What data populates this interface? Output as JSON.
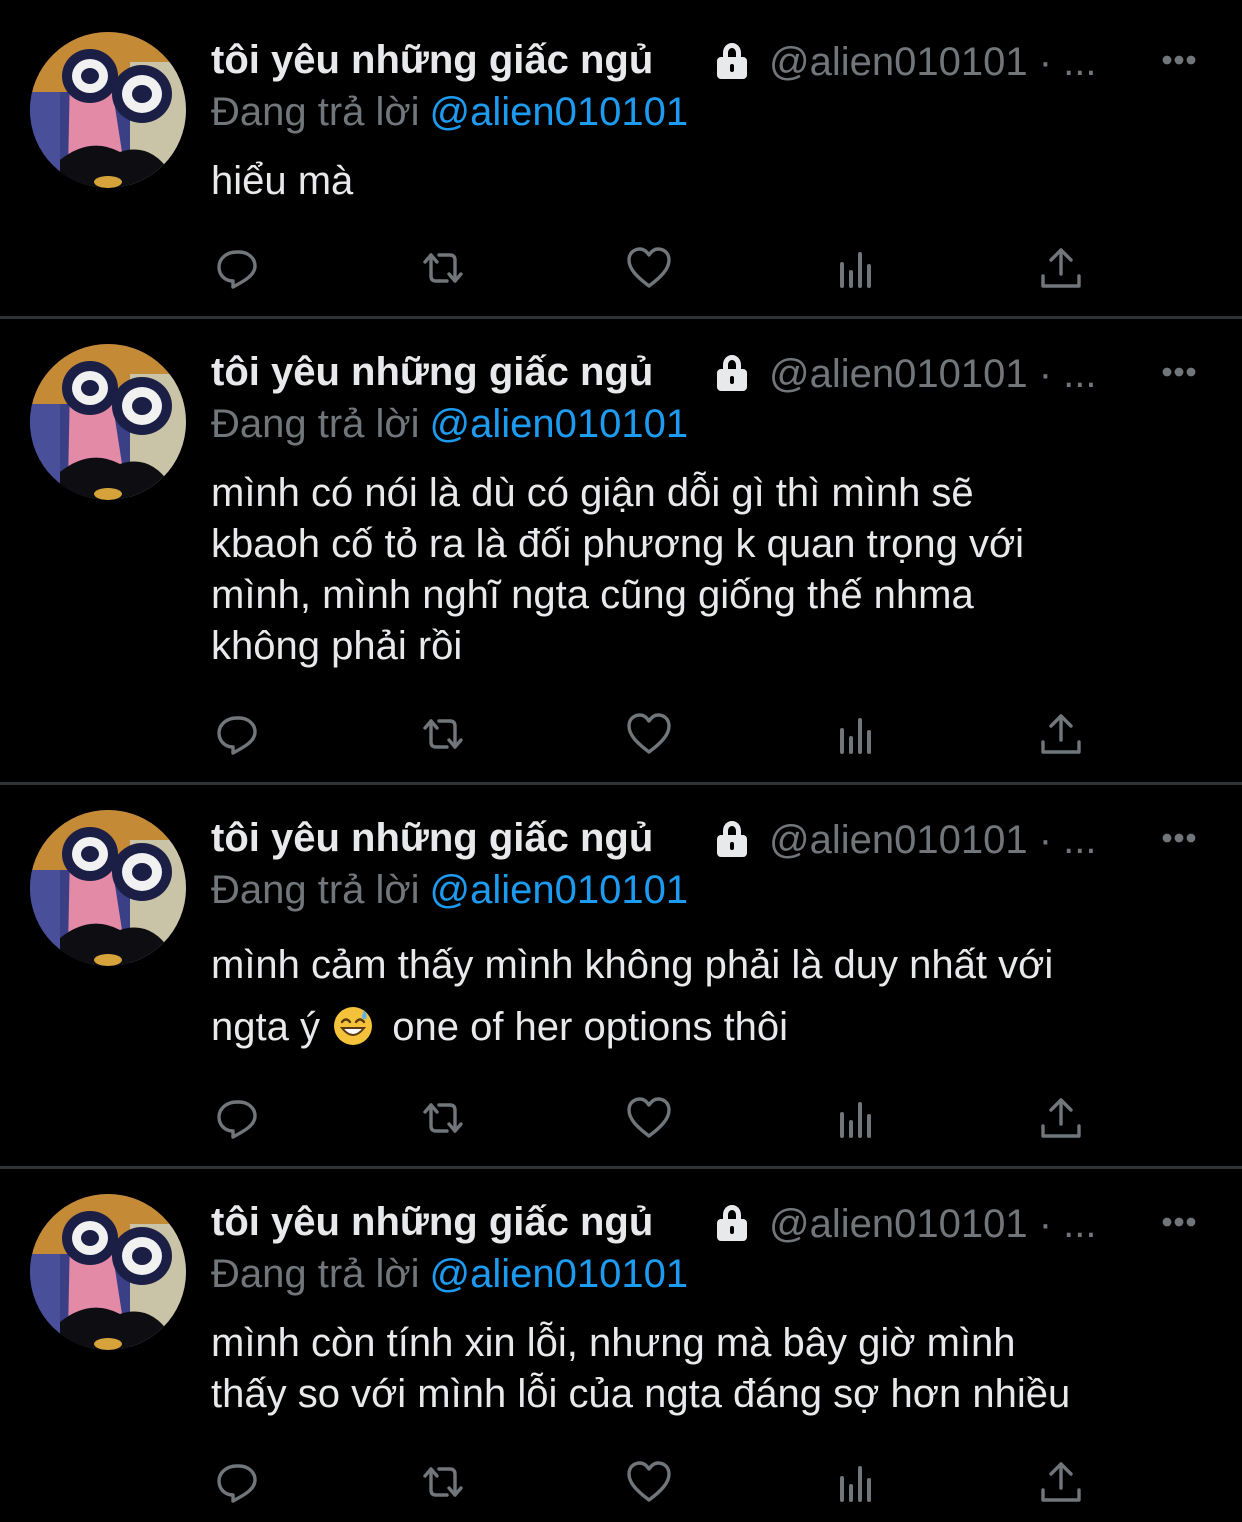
{
  "author": {
    "name": "tôi yêu những giấc ngủ",
    "handle": "@alien010101 · ...",
    "reply_prefix": "Đang trả lời",
    "reply_to": "@alien010101"
  },
  "icons": {
    "lock": "lock-icon",
    "more": "more-icon",
    "reply": "reply-icon",
    "retweet": "retweet-icon",
    "like": "heart-icon",
    "analytics": "analytics-icon",
    "share": "share-icon"
  },
  "colors": {
    "background": "#000000",
    "text": "#e7e9ea",
    "muted": "#71767b",
    "link": "#1d9bf0",
    "divider": "#2f3336"
  },
  "tweets": [
    {
      "lines": [
        "hiểu mà"
      ]
    },
    {
      "lines": [
        "mình có nói là dù có giận dỗi gì thì mình sẽ",
        "kbaoh cố tỏ ra là đối phương k quan trọng với",
        "mình, mình nghĩ ngta cũng giống thế nhma",
        "không phải rồi"
      ]
    },
    {
      "lines": [
        "mình cảm thấy mình không phải là duy nhất với"
      ],
      "before_emoji": "ngta ý",
      "emoji": "grinning-face-with-sweat",
      "after_emoji": "one of her options thôi"
    },
    {
      "lines": [
        "mình còn tính xin lỗi, nhưng mà bây giờ mình",
        "thấy so với mình lỗi của ngta đáng sợ hơn nhiều"
      ]
    }
  ]
}
